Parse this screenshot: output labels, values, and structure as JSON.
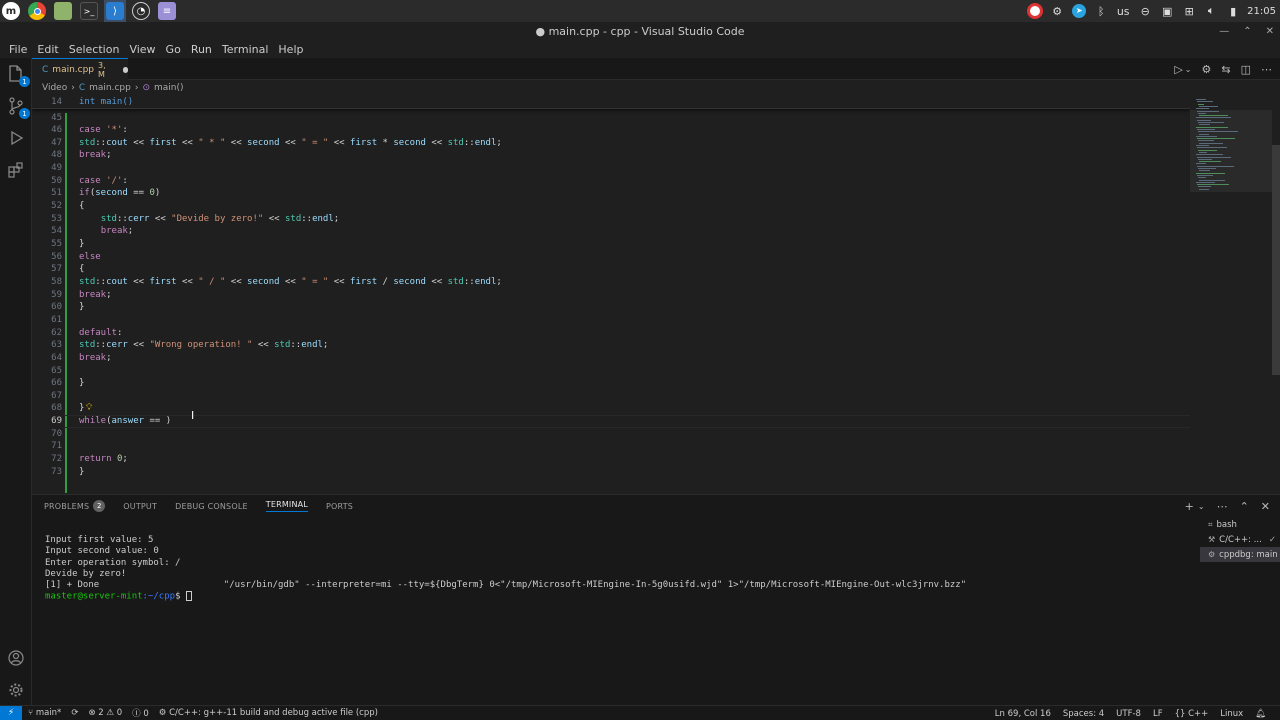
{
  "os_panel": {
    "launchers": [
      "menu-icon",
      "chrome-icon",
      "files-icon",
      "terminal-icon",
      "vscode-icon",
      "obs-icon",
      "notes-icon"
    ],
    "tray": {
      "keyboard_layout": "us",
      "clock": "21:05"
    }
  },
  "window": {
    "title": "● main.cpp - cpp - Visual Studio Code"
  },
  "menu": [
    "File",
    "Edit",
    "Selection",
    "View",
    "Go",
    "Run",
    "Terminal",
    "Help"
  ],
  "activity": {
    "explorer_badge": "1",
    "source_control_badge": "1"
  },
  "tab": {
    "label": "main.cpp",
    "suffix": "3, M"
  },
  "breadcrumb": {
    "folder": "Video",
    "file": "main.cpp",
    "symbol": "main()"
  },
  "sticky": {
    "line_number": "14",
    "text": "int main()"
  },
  "editor": {
    "lines": [
      {
        "n": "45",
        "t": ""
      },
      {
        "n": "46",
        "t": "case '*':"
      },
      {
        "n": "47",
        "t": "std::cout << first << \" * \" << second << \" = \" << first * second << std::endl;"
      },
      {
        "n": "48",
        "t": "break;"
      },
      {
        "n": "49",
        "t": ""
      },
      {
        "n": "50",
        "t": "case '/':"
      },
      {
        "n": "51",
        "t": "if(second == 0)"
      },
      {
        "n": "52",
        "t": "{"
      },
      {
        "n": "53",
        "t": "    std::cerr << \"Devide by zero!\" << std::endl;"
      },
      {
        "n": "54",
        "t": "    break;"
      },
      {
        "n": "55",
        "t": "}"
      },
      {
        "n": "56",
        "t": "else"
      },
      {
        "n": "57",
        "t": "{"
      },
      {
        "n": "58",
        "t": "std::cout << first << \" / \" << second << \" = \" << first / second << std::endl;"
      },
      {
        "n": "59",
        "t": "break;"
      },
      {
        "n": "60",
        "t": "}"
      },
      {
        "n": "61",
        "t": ""
      },
      {
        "n": "62",
        "t": "default:"
      },
      {
        "n": "63",
        "t": "std::cerr << \"Wrong operation! \" << std::endl;"
      },
      {
        "n": "64",
        "t": "break;"
      },
      {
        "n": "65",
        "t": ""
      },
      {
        "n": "66",
        "t": "}"
      },
      {
        "n": "67",
        "t": ""
      },
      {
        "n": "68",
        "t": "}"
      },
      {
        "n": "69",
        "t": "while(answer == )"
      },
      {
        "n": "70",
        "t": ""
      },
      {
        "n": "71",
        "t": ""
      },
      {
        "n": "72",
        "t": "return 0;"
      },
      {
        "n": "73",
        "t": "}"
      }
    ]
  },
  "panel": {
    "tabs": {
      "problems": "PROBLEMS",
      "problems_count": "2",
      "output": "OUTPUT",
      "debug_console": "DEBUG CONSOLE",
      "terminal": "TERMINAL",
      "ports": "PORTS"
    },
    "terminal_lines": [
      "Input first value: 5",
      "Input second value: 0",
      "Enter operation symbol: /",
      "Devide by zero!",
      "[1] + Done                       \"/usr/bin/gdb\" --interpreter=mi --tty=${DbgTerm} 0<\"/tmp/Microsoft-MIEngine-In-5g0usifd.wjd\" 1>\"/tmp/Microsoft-MIEngine-Out-wlc3jrnv.bzz\""
    ],
    "prompt": {
      "user_host": "master@server-mint",
      "path": ":~/cpp",
      "symbol": "$"
    },
    "terminal_list": [
      "bash",
      "C/C++: ...",
      "cppdbg: main"
    ]
  },
  "status": {
    "branch": "main*",
    "errors": "2",
    "warnings": "0",
    "info": "0",
    "task": "C/C++: g++-11 build and debug active file (cpp)",
    "position": "Ln 69, Col 16",
    "spaces": "Spaces: 4",
    "encoding": "UTF-8",
    "eol": "LF",
    "language": "C++",
    "os": "Linux"
  }
}
